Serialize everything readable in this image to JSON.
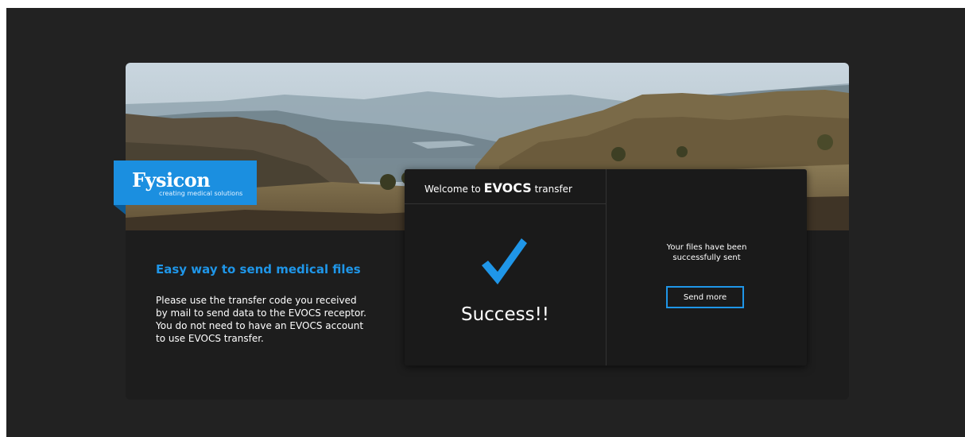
{
  "brand": {
    "name": "Fysicon",
    "tagline": "creating medical solutions"
  },
  "intro": {
    "heading": "Easy way to send medical files",
    "body": "Please use the transfer code you received by mail to send data to the EVOCS receptor. You do not need to have an EVOCS account to use EVOCS transfer."
  },
  "panel": {
    "title_prefix": "Welcome to ",
    "title_brand": "EVOCS",
    "title_suffix": " transfer",
    "status_icon": "checkmark-icon",
    "status_text": "Success!!",
    "message_line1": "Your files have been",
    "message_line2": "successfully sent",
    "send_more_label": "Send more"
  },
  "colors": {
    "accent": "#1f96e8",
    "logo_bg": "#1b8fe0",
    "page_bg": "#222222",
    "card_bg": "#1d1d1d",
    "panel_bg": "#1a1a1a"
  }
}
